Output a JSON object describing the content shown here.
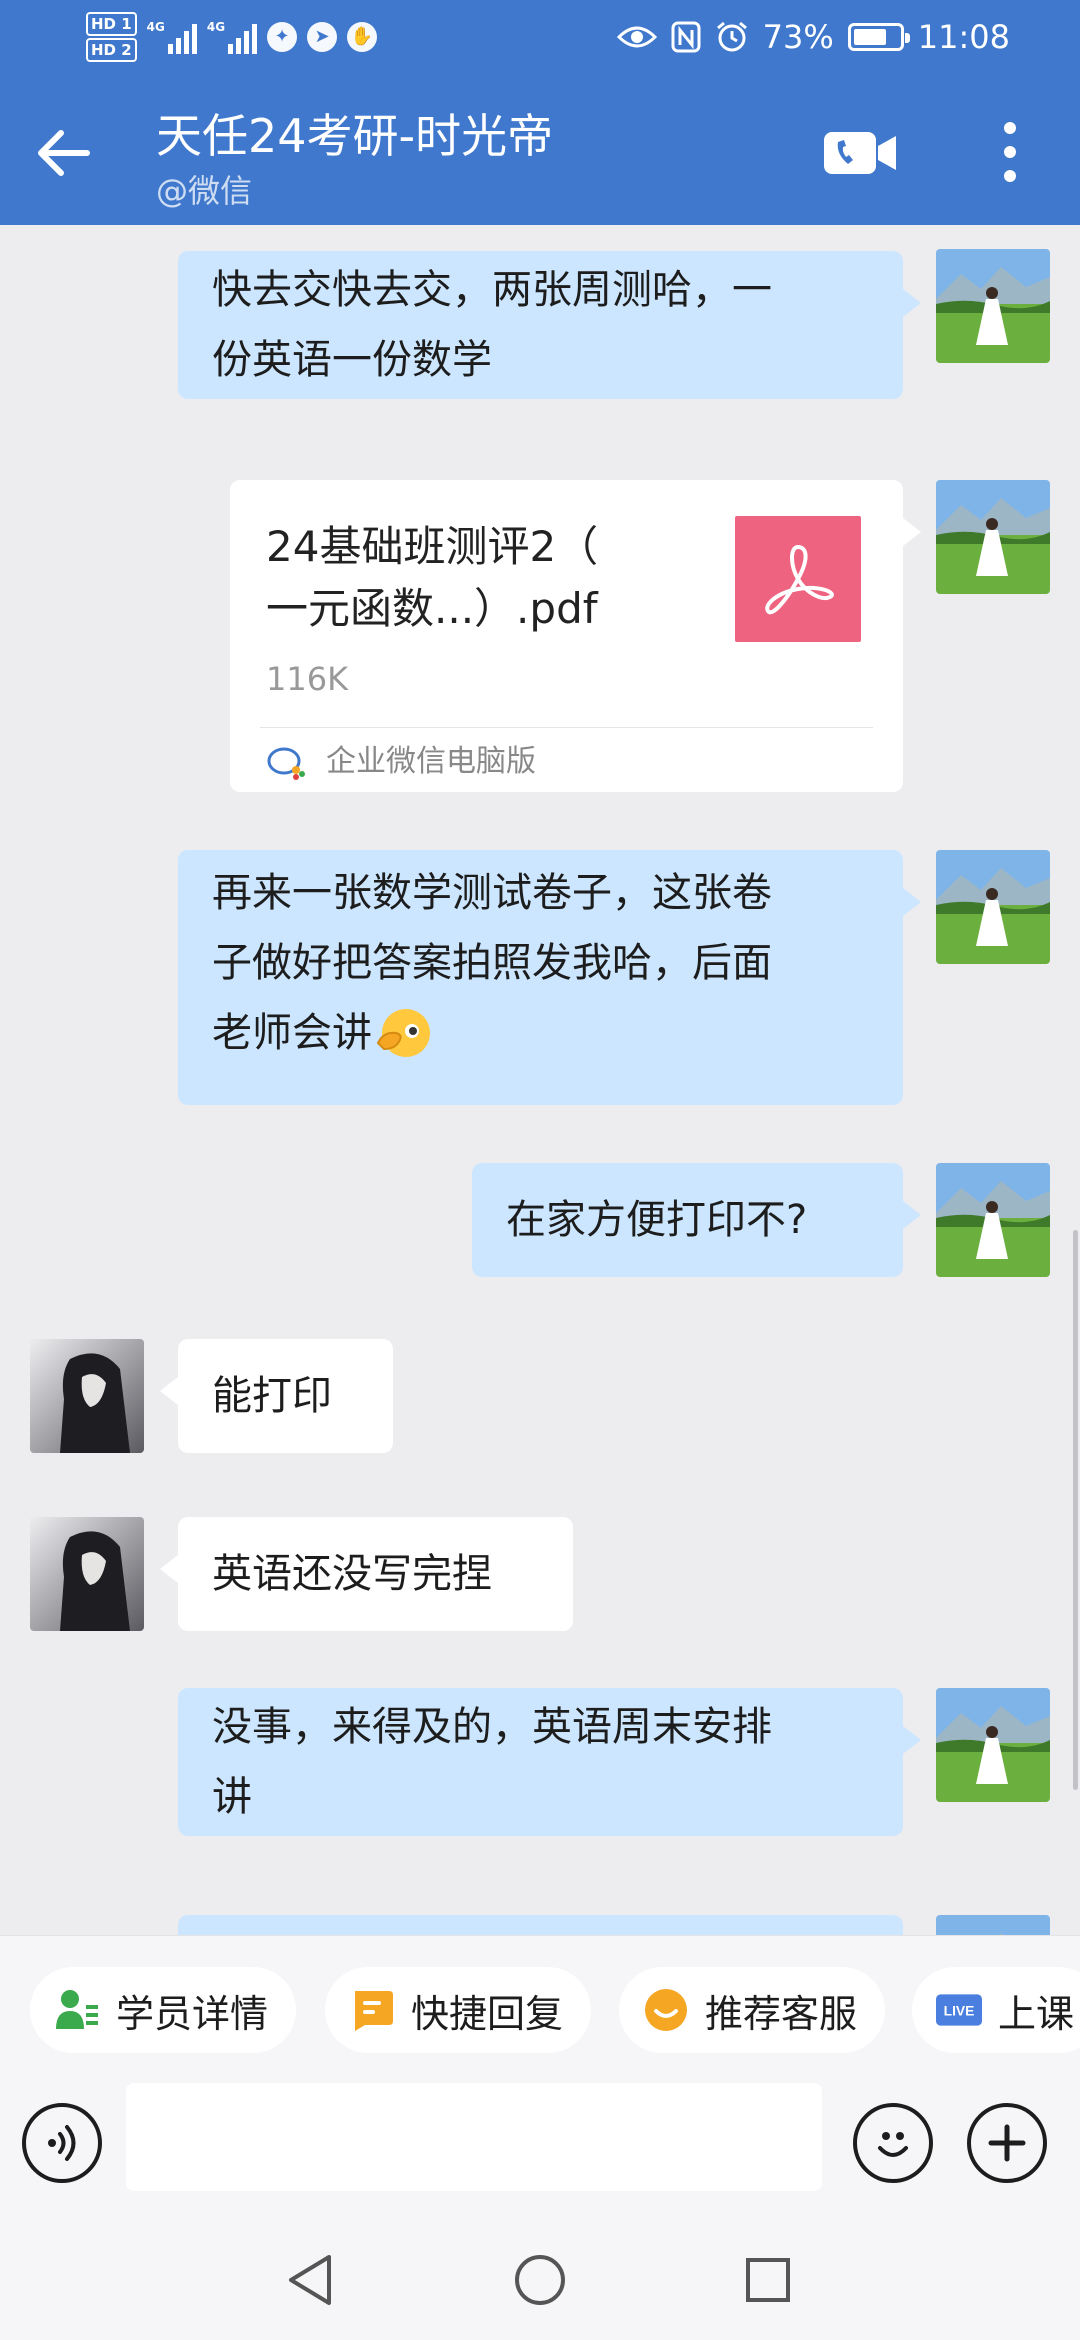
{
  "status_bar": {
    "sim1": "HD 1",
    "sim2": "HD 2",
    "network": "4G",
    "battery": "73%",
    "battery_level": 0.73,
    "time": "11:08"
  },
  "header": {
    "title": "天任24考研-时光帝",
    "subtitle": "@微信",
    "icons": [
      "back-arrow-icon",
      "video-call-icon",
      "more-vertical-icon"
    ]
  },
  "messages": [
    {
      "sender": "self",
      "text_lines": [
        "快去交快去交，两张周测哈，一",
        "份英语一份数学"
      ]
    },
    {
      "sender": "self",
      "type": "file",
      "file_name_lines": [
        "24基础班测评2（",
        "一元函数...）.pdf"
      ],
      "size": "116K",
      "source": "企业微信电脑版",
      "file_icon": "pdf-icon"
    },
    {
      "sender": "self",
      "text_lines": [
        "再来一张数学测试卷子，这张卷",
        "子做好把答案拍照发我哈，后面",
        "老师会讲"
      ],
      "emoji": "peek-emoji"
    },
    {
      "sender": "self",
      "text_lines": [
        "在家方便打印不?"
      ]
    },
    {
      "sender": "other",
      "text_lines": [
        "能打印"
      ]
    },
    {
      "sender": "other",
      "text_lines": [
        "英语还没写完捏"
      ]
    },
    {
      "sender": "self",
      "text_lines": [
        "没事，来得及的，英语周末安排",
        "讲"
      ]
    }
  ],
  "quick_actions": [
    {
      "label": "学员详情",
      "icon": "student-icon",
      "color": "#3AAA4C"
    },
    {
      "label": "快捷回复",
      "icon": "quick-reply-icon",
      "color": "#F5A623"
    },
    {
      "label": "推荐客服",
      "icon": "recommend-icon",
      "color": "#F5A623"
    },
    {
      "label": "上课",
      "icon": "live-icon",
      "icon_text": "LIVE",
      "color": "#4A7FE0"
    }
  ],
  "input": {
    "placeholder": "",
    "icons": [
      "voice-icon",
      "emoji-icon",
      "plus-icon"
    ]
  },
  "nav": {
    "icons": [
      "nav-back-icon",
      "nav-home-icon",
      "nav-recents-icon"
    ]
  }
}
